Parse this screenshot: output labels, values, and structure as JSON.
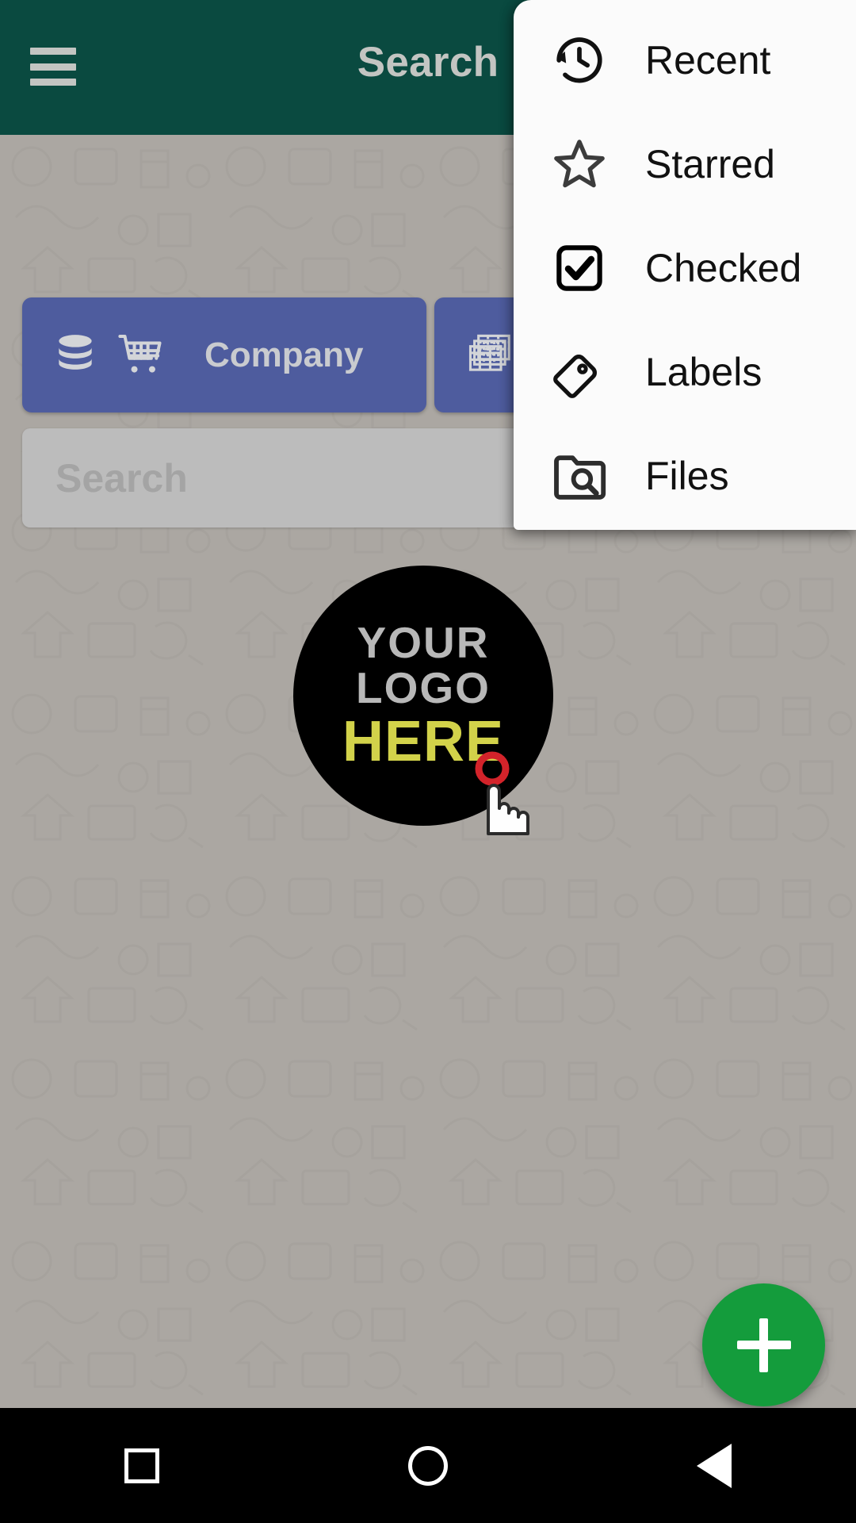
{
  "appbar": {
    "title": "Search",
    "menu_icon": "hamburger-icon",
    "background_color": "#0a4a40",
    "title_color": "#c3c5c2"
  },
  "categories": [
    {
      "label": "Company",
      "icons": [
        "database-icon",
        "shopping-cart-icon"
      ],
      "color": "#4e5c9e"
    },
    {
      "label": "",
      "icons": [
        "spreadsheet-stack-icon"
      ],
      "color": "#4e5c9e"
    }
  ],
  "search": {
    "placeholder": "Search",
    "value": "",
    "caret_icon": "chevron-down-icon",
    "background_color": "#bcbcbc"
  },
  "logo": {
    "line1": "YOUR",
    "line2": "LOGO",
    "line3": "HERE",
    "circle_color": "#000000",
    "text_color": "#b8b8b8",
    "accent_color": "#d2d24a"
  },
  "popup_menu": {
    "items": [
      {
        "label": "Recent",
        "icon": "history-icon"
      },
      {
        "label": "Starred",
        "icon": "star-outline-icon"
      },
      {
        "label": "Checked",
        "icon": "checkbox-checked-icon"
      },
      {
        "label": "Labels",
        "icon": "tag-icon"
      },
      {
        "label": "Files",
        "icon": "folder-search-icon"
      }
    ],
    "background_color": "#fbfbfb"
  },
  "fab": {
    "label": "+",
    "icon": "plus-icon",
    "color": "#149c3c"
  },
  "navbar": {
    "items": [
      {
        "name": "recents",
        "icon": "square-icon"
      },
      {
        "name": "home",
        "icon": "circle-icon"
      },
      {
        "name": "back",
        "icon": "triangle-back-icon"
      }
    ],
    "background_color": "#000000"
  },
  "cursor": {
    "icon": "hand-pointer-icon",
    "tap_color": "#d3232a"
  }
}
